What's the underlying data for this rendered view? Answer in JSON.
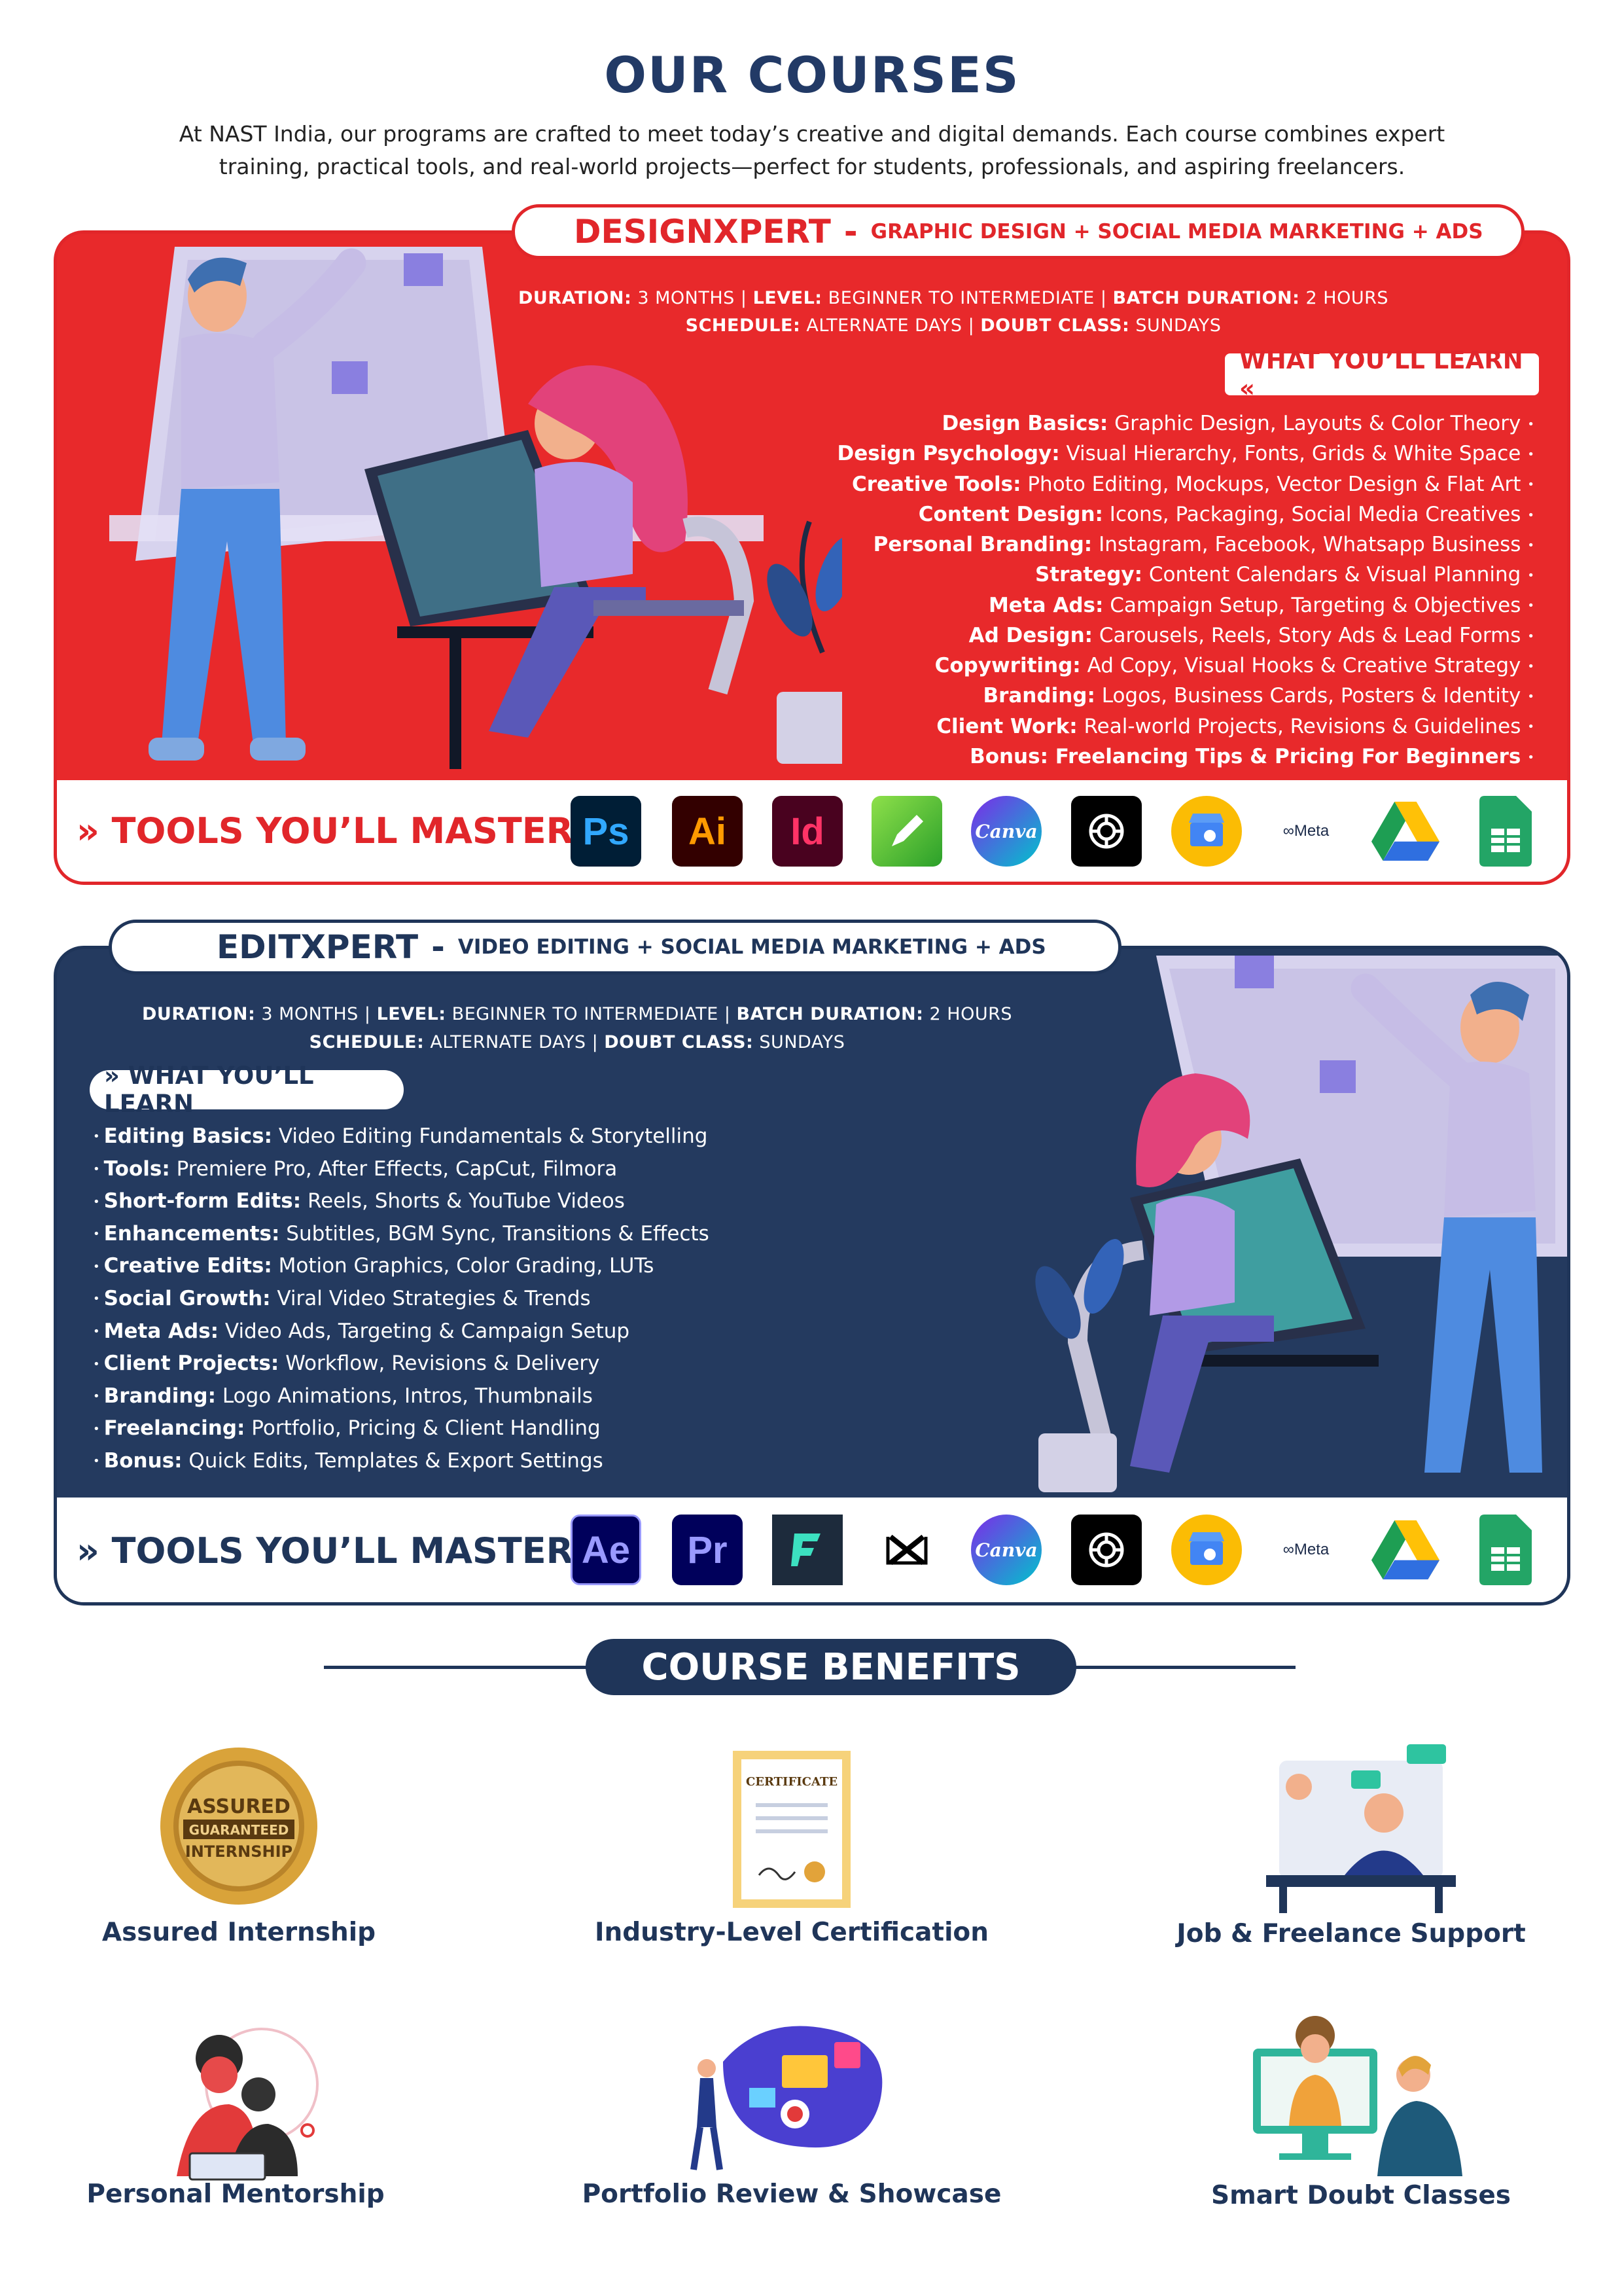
{
  "header": {
    "title": "OUR COURSES",
    "intro": "At NAST India, our programs are crafted to meet today’s creative and digital demands. Each course combines expert training, practical tools, and real-world projects—perfect for students, professionals, and aspiring freelancers."
  },
  "designxpert": {
    "name": "DESIGNXPERT",
    "dash": "-",
    "subtitle": "GRAPHIC DESIGN + SOCIAL MEDIA MARKETING + ADS",
    "meta1": {
      "duration_label": "DURATION:",
      "duration": "3 MONTHS",
      "level_label": "LEVEL:",
      "level": "BEGINNER TO INTERMEDIATE",
      "batch_label": "BATCH DURATION:",
      "batch": "2 HOURS"
    },
    "meta2": {
      "schedule_label": "SCHEDULE:",
      "schedule": "ALTERNATE DAYS",
      "doubt_label": "DOUBT CLASS:",
      "doubt": "SUNDAYS"
    },
    "learn_tag": "WHAT YOU’LL LEARN «",
    "learn": [
      {
        "k": "Design Basics:",
        "v": "Graphic Design, Layouts & Color Theory"
      },
      {
        "k": "Design Psychology:",
        "v": "Visual Hierarchy, Fonts, Grids & White Space"
      },
      {
        "k": "Creative Tools:",
        "v": "Photo Editing, Mockups, Vector Design & Flat Art"
      },
      {
        "k": "Content Design:",
        "v": "Icons, Packaging, Social Media Creatives"
      },
      {
        "k": "Personal Branding:",
        "v": "Instagram, Facebook, Whatsapp Business"
      },
      {
        "k": "Strategy:",
        "v": "Content Calendars & Visual Planning"
      },
      {
        "k": "Meta Ads:",
        "v": "Campaign Setup, Targeting & Objectives"
      },
      {
        "k": "Ad Design:",
        "v": "Carousels, Reels, Story Ads & Lead Forms"
      },
      {
        "k": "Copywriting:",
        "v": "Ad Copy, Visual Hooks & Creative Strategy"
      },
      {
        "k": "Branding:",
        "v": "Logos, Business Cards, Posters & Identity"
      },
      {
        "k": "Client Work:",
        "v": "Real-world Projects, Revisions & Guidelines"
      },
      {
        "k": "Bonus: Freelancing Tips & Pricing For Beginners",
        "v": ""
      }
    ],
    "tools_label": "» TOOLS YOU’LL MASTER:",
    "tools": [
      "Ps",
      "Ai",
      "Id",
      "",
      "Canva",
      "",
      "",
      "Meta",
      "",
      ""
    ]
  },
  "editxpert": {
    "name": "EDITXPERT",
    "dash": "-",
    "subtitle": "VIDEO EDITING + SOCIAL MEDIA MARKETING + ADS",
    "meta1": {
      "duration_label": "DURATION:",
      "duration": "3 MONTHS",
      "level_label": "LEVEL:",
      "level": "BEGINNER TO INTERMEDIATE",
      "batch_label": "BATCH DURATION:",
      "batch": "2 HOURS"
    },
    "meta2": {
      "schedule_label": "SCHEDULE:",
      "schedule": "ALTERNATE DAYS",
      "doubt_label": "DOUBT CLASS:",
      "doubt": "SUNDAYS"
    },
    "learn_tag": "» WHAT YOU’LL LEARN",
    "learn": [
      {
        "k": "Editing Basics:",
        "v": "Video Editing Fundamentals & Storytelling"
      },
      {
        "k": "Tools:",
        "v": "Premiere Pro, After Effects, CapCut, Filmora"
      },
      {
        "k": "Short-form Edits:",
        "v": "Reels, Shorts & YouTube Videos"
      },
      {
        "k": "Enhancements:",
        "v": "Subtitles, BGM Sync, Transitions & Effects"
      },
      {
        "k": "Creative Edits:",
        "v": "Motion Graphics, Color Grading, LUTs"
      },
      {
        "k": "Social Growth:",
        "v": "Viral Video Strategies & Trends"
      },
      {
        "k": "Meta Ads:",
        "v": "Video Ads, Targeting & Campaign Setup"
      },
      {
        "k": "Client Projects:",
        "v": "Workflow, Revisions & Delivery"
      },
      {
        "k": "Branding:",
        "v": "Logo Animations, Intros, Thumbnails"
      },
      {
        "k": "Freelancing:",
        "v": "Portfolio, Pricing & Client Handling"
      },
      {
        "k": "Bonus:",
        "v": "Quick Edits, Templates & Export Settings"
      }
    ],
    "tools_label": "» TOOLS YOU’LL MASTER:",
    "tools": [
      "Ae",
      "Pr",
      "",
      "",
      "Canva",
      "",
      "",
      "Meta",
      "",
      ""
    ]
  },
  "benefits": {
    "title": "COURSE BENEFITS",
    "badge_text": [
      "ASSURED",
      "GUARANTEED",
      "INTERNSHIP"
    ],
    "certificate_text": "CERTIFICATE",
    "items": [
      {
        "label": "Assured Internship",
        "icon": "internship-seal-icon"
      },
      {
        "label": "Industry-Level Certification",
        "icon": "certificate-icon"
      },
      {
        "label": "Job & Freelance Support",
        "icon": "support-agent-icon"
      },
      {
        "label": "Personal Mentorship",
        "icon": "mentorship-icon"
      },
      {
        "label": "Portfolio Review  & Showcase",
        "icon": "portfolio-icon"
      },
      {
        "label": "Smart Doubt Classes",
        "icon": "doubt-class-icon"
      }
    ]
  },
  "colors": {
    "design_red": "#e8292b",
    "edit_navy": "#243a5f",
    "title_navy": "#223a66"
  }
}
